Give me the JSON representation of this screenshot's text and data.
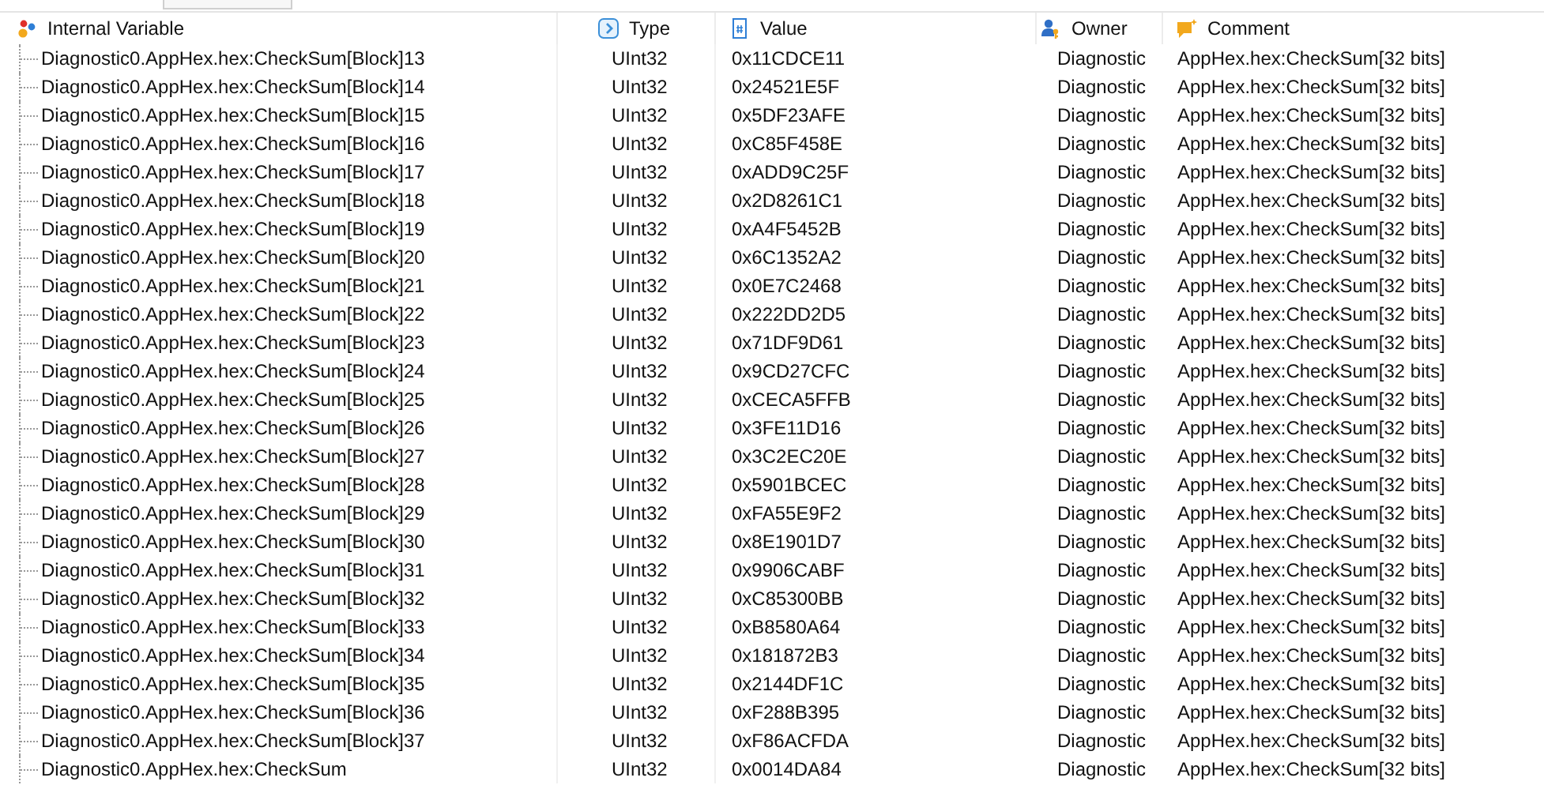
{
  "columns": [
    {
      "label": "Internal Variable",
      "kind": "name"
    },
    {
      "label": "Type",
      "kind": "type"
    },
    {
      "label": "Value",
      "kind": "value"
    },
    {
      "label": "Owner",
      "kind": "owner"
    },
    {
      "label": "Comment",
      "kind": "comment"
    }
  ],
  "rows": [
    {
      "name": "Diagnostic0.AppHex.hex:CheckSum[Block]13",
      "type": "UInt32",
      "value": "0x11CDCE11",
      "owner": "Diagnostic",
      "comment": "AppHex.hex:CheckSum[32 bits]"
    },
    {
      "name": "Diagnostic0.AppHex.hex:CheckSum[Block]14",
      "type": "UInt32",
      "value": "0x24521E5F",
      "owner": "Diagnostic",
      "comment": "AppHex.hex:CheckSum[32 bits]"
    },
    {
      "name": "Diagnostic0.AppHex.hex:CheckSum[Block]15",
      "type": "UInt32",
      "value": "0x5DF23AFE",
      "owner": "Diagnostic",
      "comment": "AppHex.hex:CheckSum[32 bits]"
    },
    {
      "name": "Diagnostic0.AppHex.hex:CheckSum[Block]16",
      "type": "UInt32",
      "value": "0xC85F458E",
      "owner": "Diagnostic",
      "comment": "AppHex.hex:CheckSum[32 bits]"
    },
    {
      "name": "Diagnostic0.AppHex.hex:CheckSum[Block]17",
      "type": "UInt32",
      "value": "0xADD9C25F",
      "owner": "Diagnostic",
      "comment": "AppHex.hex:CheckSum[32 bits]"
    },
    {
      "name": "Diagnostic0.AppHex.hex:CheckSum[Block]18",
      "type": "UInt32",
      "value": "0x2D8261C1",
      "owner": "Diagnostic",
      "comment": "AppHex.hex:CheckSum[32 bits]"
    },
    {
      "name": "Diagnostic0.AppHex.hex:CheckSum[Block]19",
      "type": "UInt32",
      "value": "0xA4F5452B",
      "owner": "Diagnostic",
      "comment": "AppHex.hex:CheckSum[32 bits]"
    },
    {
      "name": "Diagnostic0.AppHex.hex:CheckSum[Block]20",
      "type": "UInt32",
      "value": "0x6C1352A2",
      "owner": "Diagnostic",
      "comment": "AppHex.hex:CheckSum[32 bits]"
    },
    {
      "name": "Diagnostic0.AppHex.hex:CheckSum[Block]21",
      "type": "UInt32",
      "value": "0x0E7C2468",
      "owner": "Diagnostic",
      "comment": "AppHex.hex:CheckSum[32 bits]"
    },
    {
      "name": "Diagnostic0.AppHex.hex:CheckSum[Block]22",
      "type": "UInt32",
      "value": "0x222DD2D5",
      "owner": "Diagnostic",
      "comment": "AppHex.hex:CheckSum[32 bits]"
    },
    {
      "name": "Diagnostic0.AppHex.hex:CheckSum[Block]23",
      "type": "UInt32",
      "value": "0x71DF9D61",
      "owner": "Diagnostic",
      "comment": "AppHex.hex:CheckSum[32 bits]"
    },
    {
      "name": "Diagnostic0.AppHex.hex:CheckSum[Block]24",
      "type": "UInt32",
      "value": "0x9CD27CFC",
      "owner": "Diagnostic",
      "comment": "AppHex.hex:CheckSum[32 bits]"
    },
    {
      "name": "Diagnostic0.AppHex.hex:CheckSum[Block]25",
      "type": "UInt32",
      "value": "0xCECA5FFB",
      "owner": "Diagnostic",
      "comment": "AppHex.hex:CheckSum[32 bits]"
    },
    {
      "name": "Diagnostic0.AppHex.hex:CheckSum[Block]26",
      "type": "UInt32",
      "value": "0x3FE11D16",
      "owner": "Diagnostic",
      "comment": "AppHex.hex:CheckSum[32 bits]"
    },
    {
      "name": "Diagnostic0.AppHex.hex:CheckSum[Block]27",
      "type": "UInt32",
      "value": "0x3C2EC20E",
      "owner": "Diagnostic",
      "comment": "AppHex.hex:CheckSum[32 bits]"
    },
    {
      "name": "Diagnostic0.AppHex.hex:CheckSum[Block]28",
      "type": "UInt32",
      "value": "0x5901BCEC",
      "owner": "Diagnostic",
      "comment": "AppHex.hex:CheckSum[32 bits]"
    },
    {
      "name": "Diagnostic0.AppHex.hex:CheckSum[Block]29",
      "type": "UInt32",
      "value": "0xFA55E9F2",
      "owner": "Diagnostic",
      "comment": "AppHex.hex:CheckSum[32 bits]"
    },
    {
      "name": "Diagnostic0.AppHex.hex:CheckSum[Block]30",
      "type": "UInt32",
      "value": "0x8E1901D7",
      "owner": "Diagnostic",
      "comment": "AppHex.hex:CheckSum[32 bits]"
    },
    {
      "name": "Diagnostic0.AppHex.hex:CheckSum[Block]31",
      "type": "UInt32",
      "value": "0x9906CABF",
      "owner": "Diagnostic",
      "comment": "AppHex.hex:CheckSum[32 bits]"
    },
    {
      "name": "Diagnostic0.AppHex.hex:CheckSum[Block]32",
      "type": "UInt32",
      "value": "0xC85300BB",
      "owner": "Diagnostic",
      "comment": "AppHex.hex:CheckSum[32 bits]"
    },
    {
      "name": "Diagnostic0.AppHex.hex:CheckSum[Block]33",
      "type": "UInt32",
      "value": "0xB8580A64",
      "owner": "Diagnostic",
      "comment": "AppHex.hex:CheckSum[32 bits]"
    },
    {
      "name": "Diagnostic0.AppHex.hex:CheckSum[Block]34",
      "type": "UInt32",
      "value": "0x181872B3",
      "owner": "Diagnostic",
      "comment": "AppHex.hex:CheckSum[32 bits]"
    },
    {
      "name": "Diagnostic0.AppHex.hex:CheckSum[Block]35",
      "type": "UInt32",
      "value": "0x2144DF1C",
      "owner": "Diagnostic",
      "comment": "AppHex.hex:CheckSum[32 bits]"
    },
    {
      "name": "Diagnostic0.AppHex.hex:CheckSum[Block]36",
      "type": "UInt32",
      "value": "0xF288B395",
      "owner": "Diagnostic",
      "comment": "AppHex.hex:CheckSum[32 bits]"
    },
    {
      "name": "Diagnostic0.AppHex.hex:CheckSum[Block]37",
      "type": "UInt32",
      "value": "0xF86ACFDA",
      "owner": "Diagnostic",
      "comment": "AppHex.hex:CheckSum[32 bits]"
    },
    {
      "name": "Diagnostic0.AppHex.hex:CheckSum",
      "type": "UInt32",
      "value": "0x0014DA84",
      "owner": "Diagnostic",
      "comment": "AppHex.hex:CheckSum[32 bits]"
    }
  ]
}
